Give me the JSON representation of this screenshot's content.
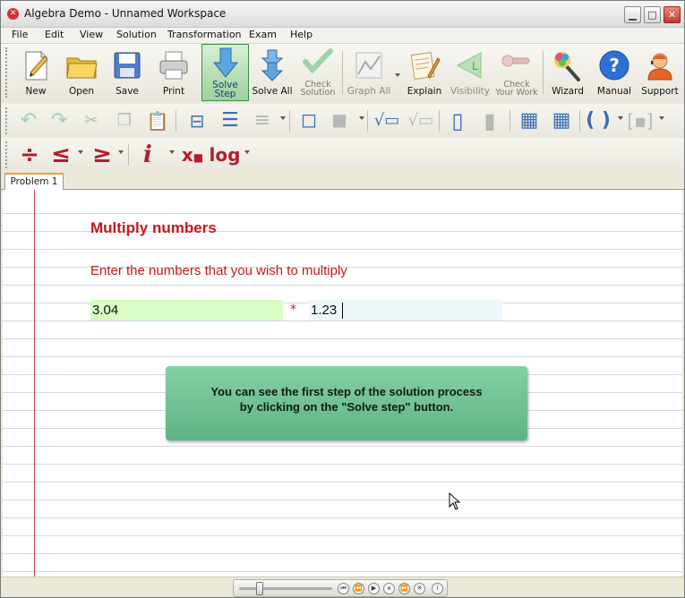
{
  "window": {
    "title": "Algebra Demo - Unnamed Workspace"
  },
  "menu": [
    "File",
    "Edit",
    "View",
    "Solution",
    "Transformation",
    "Exam",
    "Help"
  ],
  "toolbar": {
    "new": "New",
    "open": "Open",
    "save": "Save",
    "print": "Print",
    "solve_step_1": "Solve",
    "solve_step_2": "Step",
    "solve_all": "Solve All",
    "check_solution_1": "Check",
    "check_solution_2": "Solution",
    "graph_all": "Graph All",
    "explain": "Explain",
    "visibility": "Visibility",
    "check_work_1": "Check",
    "check_work_2": "Your Work",
    "wizard": "Wizard",
    "manual": "Manual",
    "support": "Support"
  },
  "symbols": {
    "divide": "÷",
    "leq": "≤",
    "geq": "≥",
    "imag": "i",
    "subscript": "x",
    "log": "log",
    "paren_open": "(",
    "paren_close": ")"
  },
  "tabs": [
    {
      "label": "Problem 1",
      "active": true
    }
  ],
  "problem": {
    "heading": "Multiply numbers",
    "prompt": "Enter the numbers that you wish to multiply",
    "operand_a": "3.04",
    "operator": "*",
    "operand_b": "1.23"
  },
  "hint": {
    "line1": "You can see the first step of the solution process",
    "line2": "by clicking on the \"Solve step\" button."
  },
  "colors": {
    "accent_red": "#c8161d",
    "hint_green": "#6fc292",
    "input_a_bg": "#d8fdc4",
    "input_b_bg": "#eef8fb"
  }
}
